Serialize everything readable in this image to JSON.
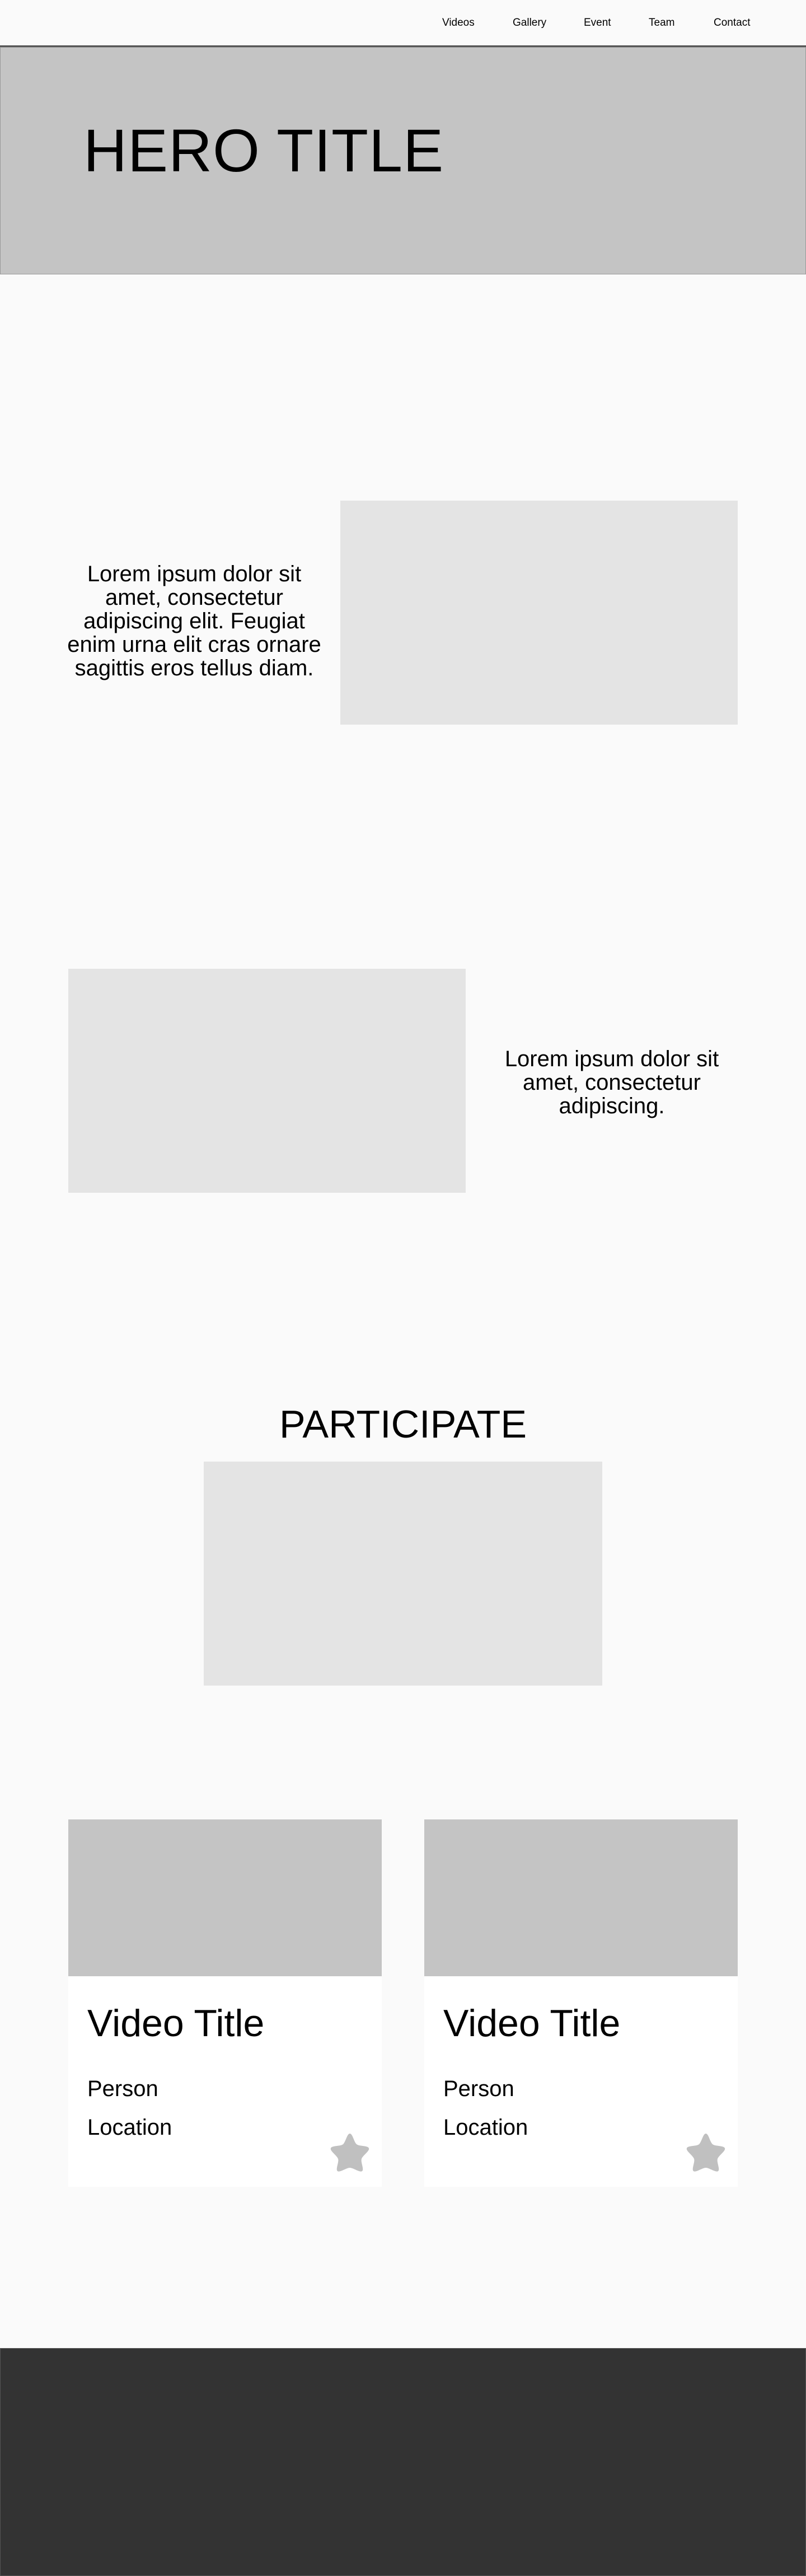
{
  "nav": {
    "items": [
      {
        "label": "Videos"
      },
      {
        "label": "Gallery"
      },
      {
        "label": "Event"
      },
      {
        "label": "Team"
      },
      {
        "label": "Contact"
      }
    ]
  },
  "hero": {
    "title": "HERO TITLE"
  },
  "section1": {
    "text": "Lorem ipsum dolor sit amet, consectetur adipiscing elit. Feugiat enim urna elit cras ornare sagittis eros tellus diam."
  },
  "section2": {
    "text": "Lorem ipsum dolor sit amet, consectetur adipiscing."
  },
  "participate": {
    "heading": "PARTICIPATE"
  },
  "cards": [
    {
      "title": "Video Title",
      "person": "Person",
      "location": "Location",
      "icon": "star-icon"
    },
    {
      "title": "Video Title",
      "person": "Person",
      "location": "Location",
      "icon": "star-icon"
    }
  ],
  "colors": {
    "background": "#fafafa",
    "hero": "#c4c4c4",
    "placeholder": "#e4e4e4",
    "footer": "#333333",
    "star": "#c0c0c0"
  }
}
